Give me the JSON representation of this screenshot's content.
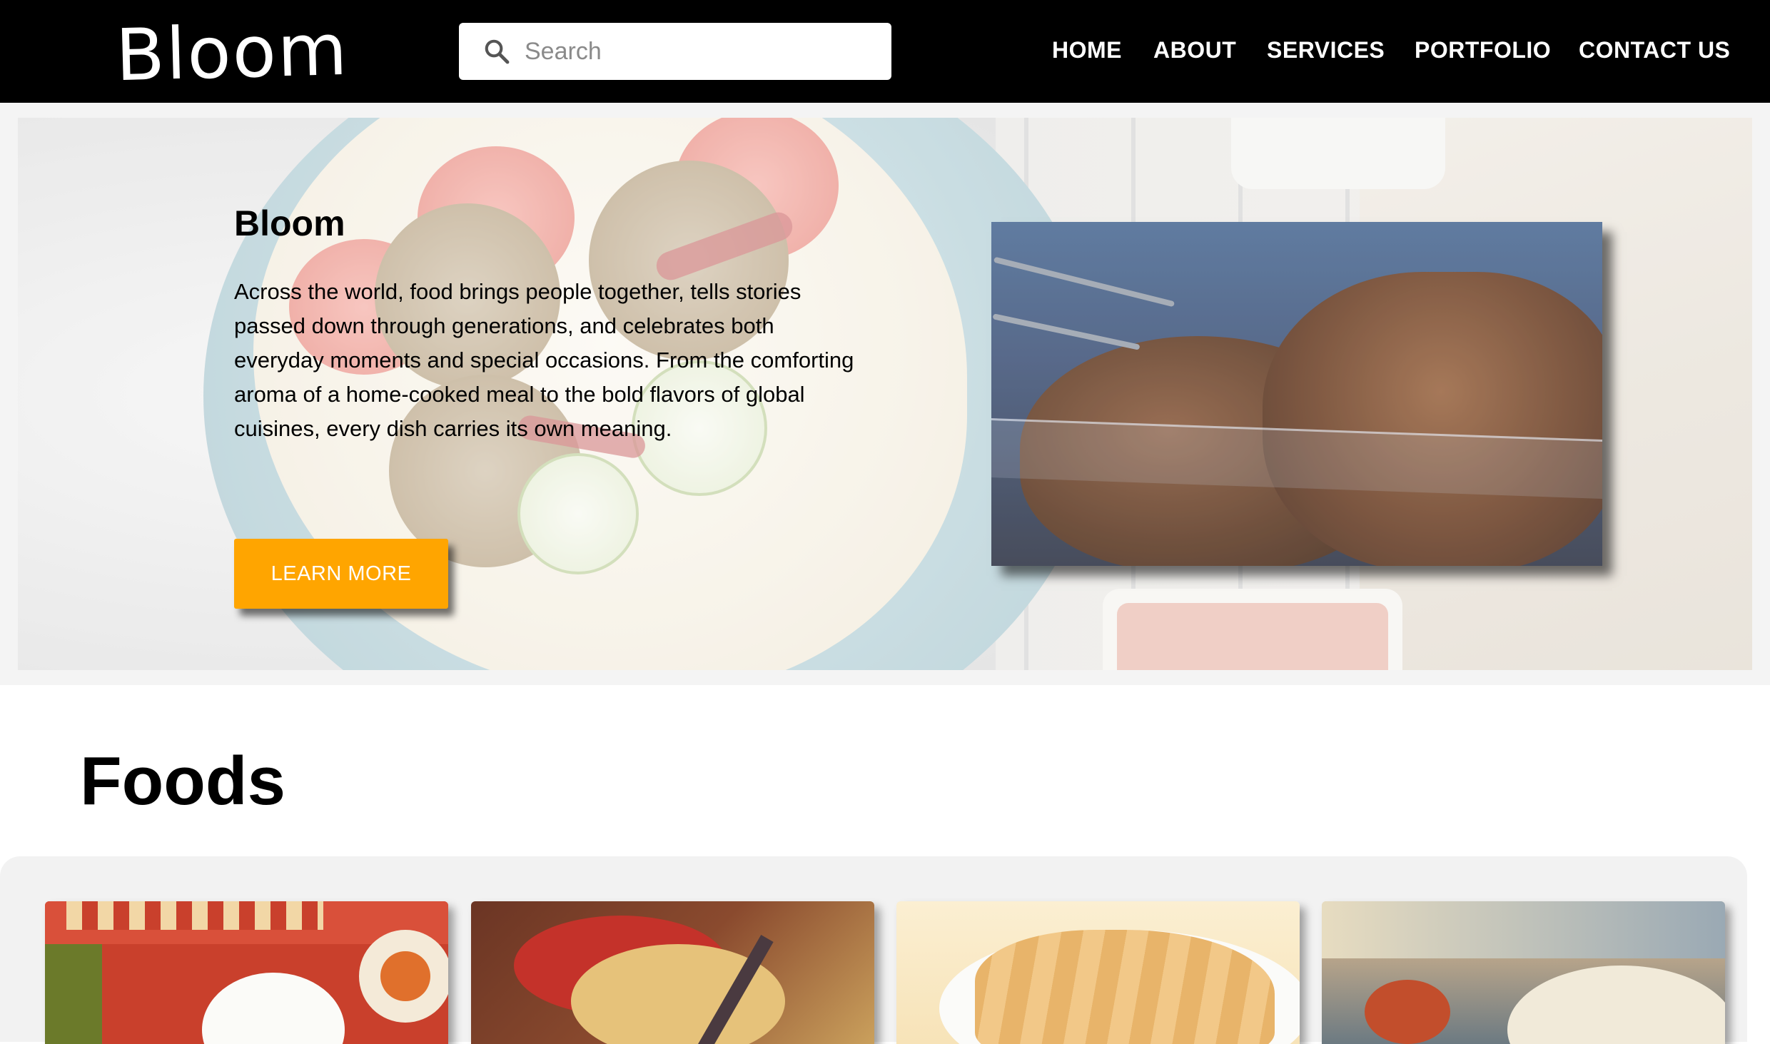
{
  "header": {
    "logo": "Bloom",
    "search_placeholder": "Search",
    "nav": [
      {
        "label": "HOME"
      },
      {
        "label": "ABOUT"
      },
      {
        "label": "SERVICES"
      },
      {
        "label": "PORTFOLIO"
      },
      {
        "label": "CONTACT US"
      }
    ]
  },
  "hero": {
    "title": "Bloom",
    "text": "Across the world, food brings people together, tells stories passed down through generations, and celebrates both everyday moments and special occasions. From the comforting aroma of a home-cooked meal to the bold flavors of global cuisines, every dish carries its own meaning.",
    "button_label": "LEARN MORE",
    "accent_color": "#ffa500"
  },
  "foods": {
    "title": "Foods"
  }
}
